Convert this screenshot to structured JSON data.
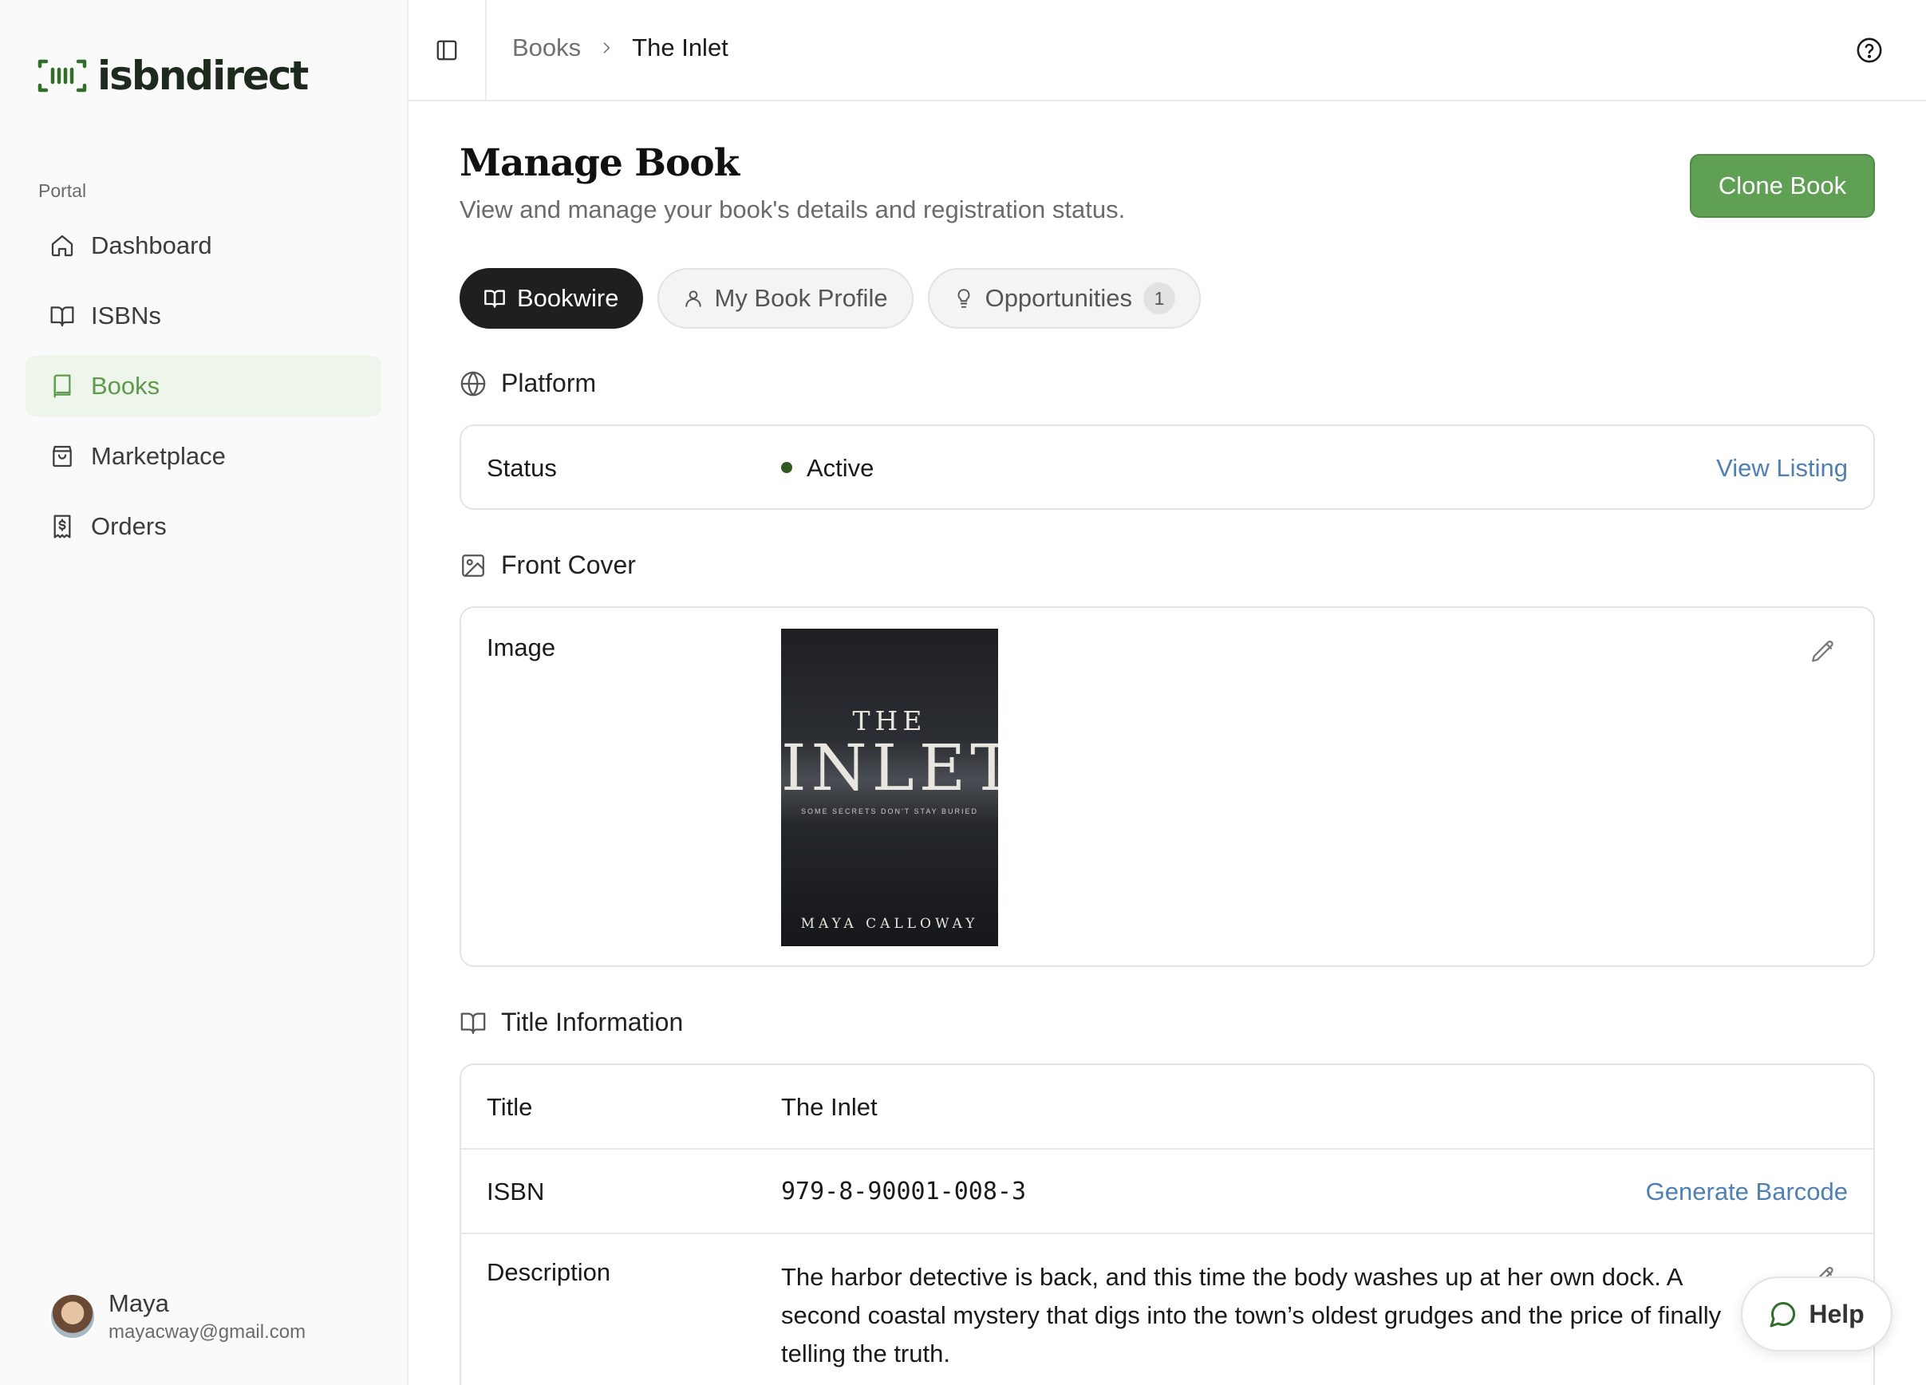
{
  "brand": {
    "name": "isbndirect"
  },
  "sidebar": {
    "section_label": "Portal",
    "items": [
      {
        "label": "Dashboard",
        "icon": "home-icon"
      },
      {
        "label": "ISBNs",
        "icon": "open-book-icon"
      },
      {
        "label": "Books",
        "icon": "book-icon",
        "active": true
      },
      {
        "label": "Marketplace",
        "icon": "shopping-bag-icon"
      },
      {
        "label": "Orders",
        "icon": "receipt-icon"
      }
    ]
  },
  "user": {
    "name": "Maya",
    "email": "mayacway@gmail.com"
  },
  "breadcrumb": {
    "parent": "Books",
    "current": "The Inlet"
  },
  "page": {
    "title": "Manage Book",
    "subtitle": "View and manage your book's details and registration status.",
    "clone_label": "Clone Book"
  },
  "tabs": [
    {
      "label": "Bookwire",
      "icon": "open-book-icon",
      "active": true
    },
    {
      "label": "My Book Profile",
      "icon": "user-icon"
    },
    {
      "label": "Opportunities",
      "icon": "lightbulb-icon",
      "badge": "1"
    }
  ],
  "platform": {
    "heading": "Platform",
    "status_label": "Status",
    "status_value": "Active",
    "link": "View Listing"
  },
  "front_cover": {
    "heading": "Front Cover",
    "image_label": "Image",
    "cover": {
      "the": "THE",
      "title": "INLET",
      "tagline": "SOME SECRETS DON'T STAY BURIED",
      "author": "MAYA CALLOWAY"
    }
  },
  "title_info": {
    "heading": "Title Information",
    "title_label": "Title",
    "title_value": "The Inlet",
    "isbn_label": "ISBN",
    "isbn_value": "979-8-90001-008-3",
    "barcode_link": "Generate Barcode",
    "description_label": "Description",
    "description_value": "The harbor detective is back, and this time the body washes up at her own dock. A second coastal mystery that digs into the town’s oldest grudges and the price of finally telling the truth."
  },
  "help_button": {
    "label": "Help"
  },
  "colors": {
    "accent": "#5fa055",
    "link": "#4f7fb3",
    "active_nav_bg": "#eef5ea"
  }
}
